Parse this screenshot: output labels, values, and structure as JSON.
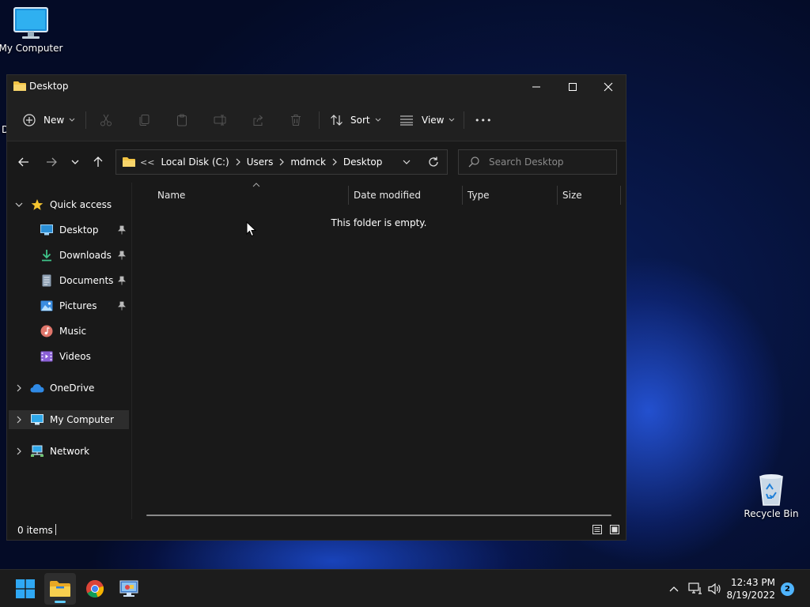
{
  "desktop": {
    "icons": {
      "my_computer": "My Computer",
      "recycle_bin": "Recycle Bin"
    },
    "edge_fragment": "D"
  },
  "window": {
    "title": "Desktop",
    "controls": {
      "minimize": "minimize",
      "maximize": "maximize",
      "close": "close"
    }
  },
  "command_bar": {
    "new_label": "New",
    "sort_label": "Sort",
    "view_label": "View",
    "more_label": "•••"
  },
  "address": {
    "overflow": "<<",
    "crumbs": [
      "Local Disk (C:)",
      "Users",
      "mdmck",
      "Desktop"
    ]
  },
  "search": {
    "placeholder": "Search Desktop"
  },
  "sidebar": {
    "quick_access": "Quick access",
    "items": [
      {
        "label": "Desktop",
        "pinned": true,
        "icon": "desktop-icon"
      },
      {
        "label": "Downloads",
        "pinned": true,
        "icon": "downloads-icon"
      },
      {
        "label": "Documents",
        "pinned": true,
        "icon": "documents-icon"
      },
      {
        "label": "Pictures",
        "pinned": true,
        "icon": "pictures-icon"
      },
      {
        "label": "Music",
        "pinned": false,
        "icon": "music-icon"
      },
      {
        "label": "Videos",
        "pinned": false,
        "icon": "videos-icon"
      }
    ],
    "onedrive": "OneDrive",
    "my_computer": "My Computer",
    "network": "Network"
  },
  "columns": [
    "Name",
    "Date modified",
    "Type",
    "Size"
  ],
  "content": {
    "empty_message": "This folder is empty."
  },
  "status": {
    "item_count": "0 items"
  },
  "taskbar": {
    "time": "12:43 PM",
    "date": "8/19/2022",
    "notification_count": "2"
  },
  "colors": {
    "accent": "#60cdff",
    "folder": "#f3c444",
    "window_bg": "#191919",
    "titlebar_bg": "#202020"
  }
}
